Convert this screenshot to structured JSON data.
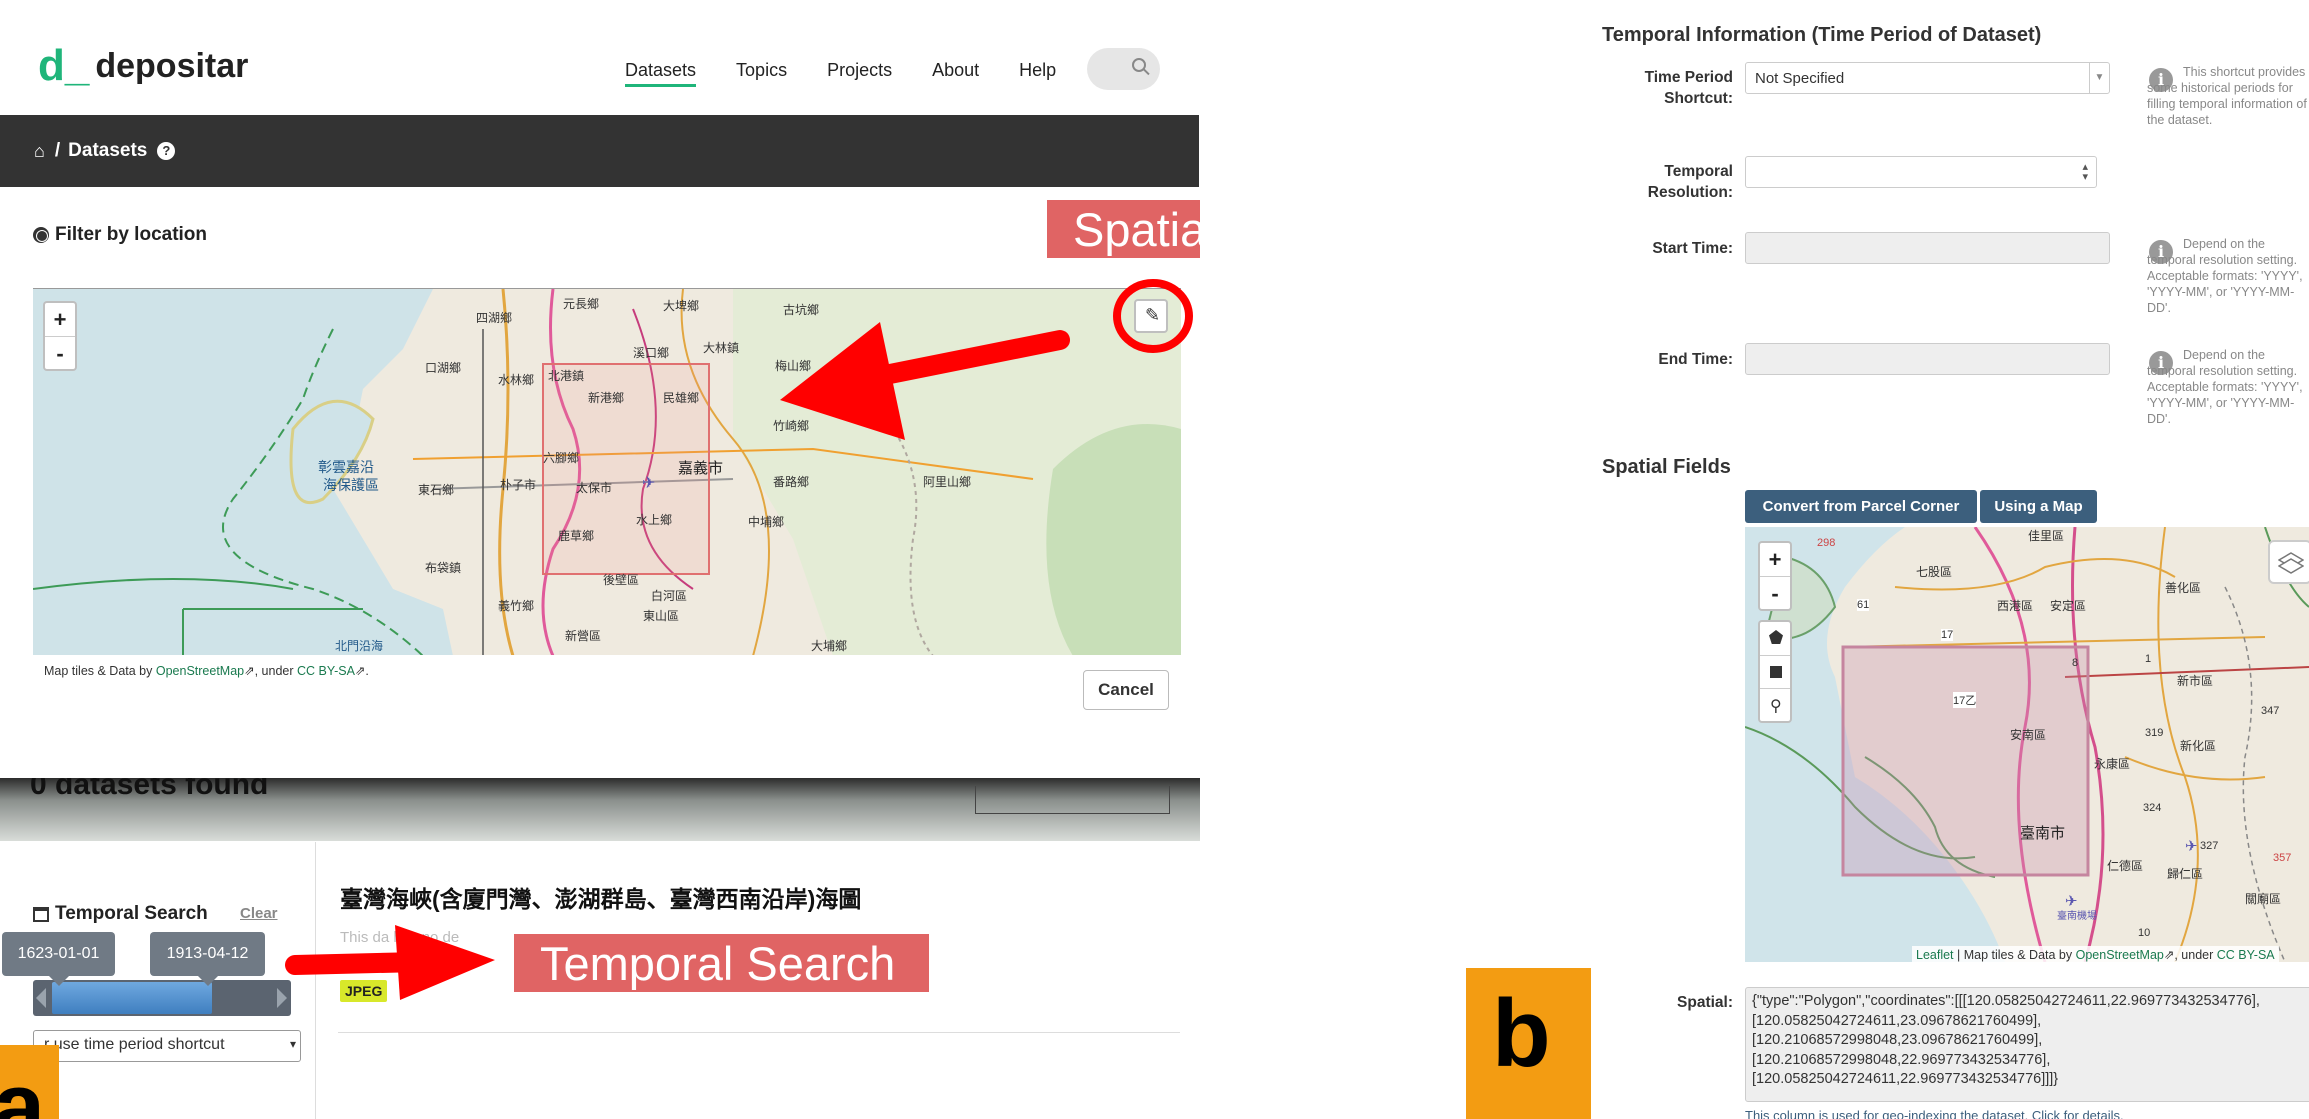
{
  "panel_a": {
    "brand": {
      "mark": "d_",
      "name": "depositar"
    },
    "nav": {
      "items": [
        {
          "label": "Datasets",
          "active": true
        },
        {
          "label": "Topics",
          "active": false
        },
        {
          "label": "Projects",
          "active": false
        },
        {
          "label": "About",
          "active": false
        },
        {
          "label": "Help",
          "active": false
        }
      ]
    },
    "breadcrumb": {
      "separator": "/",
      "current": "Datasets"
    },
    "filter": {
      "title": "Filter by location"
    },
    "map": {
      "zoom_in": "+",
      "zoom_out": "-",
      "place_labels": [
        "四湖鄉",
        "元長鄉",
        "大埤鄉",
        "古坑鄉",
        "口湖鄉",
        "溪口鄉",
        "大林鎮",
        "梅山鄉",
        "水林鄉",
        "北港鎮",
        "新港鄉",
        "民雄鄉",
        "竹崎鄉",
        "彰雲嘉沿",
        "海保護區",
        "六腳鄉",
        "東石鄉",
        "朴子市",
        "太保市",
        "嘉義市",
        "番路鄉",
        "阿里山鄉",
        "水上鄉",
        "中埔鄉",
        "鹿草鄉",
        "布袋鎮",
        "義竹鄉",
        "後壁區",
        "白河區",
        "東山區",
        "新營區",
        "北門沿海",
        "大埔鄉"
      ],
      "attribution_prefix": "Map tiles & Data by",
      "attribution_osm": "OpenStreetMap",
      "attribution_mid": ", under",
      "attribution_license": "CC BY-SA",
      "attribution_end": "."
    },
    "cancel_label": "Cancel",
    "background_heading_fragment": "0 datasets found",
    "temporal": {
      "title": "Temporal Search",
      "clear_label": "Clear",
      "start_date": "1623-01-01",
      "end_date": "1913-04-12",
      "shortcut_placeholder": "r use time period shortcut"
    },
    "dataset": {
      "title": "臺灣海峽(含廈門灣、澎湖群島、臺灣西南沿岸)海圖",
      "description_fragment": "This da   has no de",
      "format": "JPEG"
    },
    "callouts": {
      "spatial": "Spatial Search",
      "temporal": "Temporal Search"
    },
    "badge": "a"
  },
  "panel_b": {
    "temporal_section_title": "Temporal Information (Time Period of Dataset)",
    "fields": {
      "time_period_shortcut": {
        "label_line1": "Time Period",
        "label_line2": "Shortcut:",
        "value": "Not Specified",
        "help": "This shortcut provides some historical periods for filling temporal information of the dataset."
      },
      "temporal_resolution": {
        "label_line1": "Temporal",
        "label_line2": "Resolution:",
        "value": ""
      },
      "start_time": {
        "label": "Start Time:",
        "help": "Depend on the temporal resolution setting. Acceptable formats: 'YYYY', 'YYYY-MM', or 'YYYY-MM-DD'."
      },
      "end_time": {
        "label": "End Time:",
        "help": "Depend on the temporal resolution setting. Acceptable formats: 'YYYY', 'YYYY-MM', or 'YYYY-MM-DD'."
      }
    },
    "spatial_section_title": "Spatial Fields",
    "buttons": {
      "parcel": "Convert from Parcel Corner",
      "map": "Using a Map"
    },
    "map": {
      "zoom_in": "+",
      "zoom_out": "-",
      "place_labels": [
        "七股區",
        "西港區",
        "安定區",
        "善化區",
        "新市區",
        "新化區",
        "安南區",
        "永康區",
        "臺南市",
        "仁德區",
        "歸仁區",
        "關廟區",
        "臺南機場",
        "佳里區"
      ],
      "road_labels": [
        "298",
        "61",
        "17",
        "17乙",
        "8",
        "1",
        "319",
        "324",
        "327",
        "347",
        "357",
        "10"
      ],
      "attribution_leaflet": "Leaflet",
      "attribution_mid": "| Map tiles & Data by",
      "attribution_osm": "OpenStreetMap",
      "attribution_under": ", under",
      "attribution_license": "CC BY-SA"
    },
    "spatial": {
      "label": "Spatial:",
      "lines": [
        "{\"type\":\"Polygon\",\"coordinates\":[[[120.05825042724611,22.969773432534776],",
        "[120.05825042724611,23.09678621760499],",
        "[120.21068572998048,23.09678621760499],",
        "[120.21068572998048,22.969773432534776],",
        "[120.05825042724611,22.969773432534776]]]}"
      ],
      "footnote": "This column is used for geo-indexing the dataset. Click for details."
    },
    "badge": "b"
  },
  "colors": {
    "brand_green": "#1fb57a",
    "callout_red": "#e06464",
    "arrow_red": "#ff0000",
    "badge_orange": "#f39c12",
    "button_blue": "#3c5f7d",
    "dark_bar": "#333333"
  }
}
